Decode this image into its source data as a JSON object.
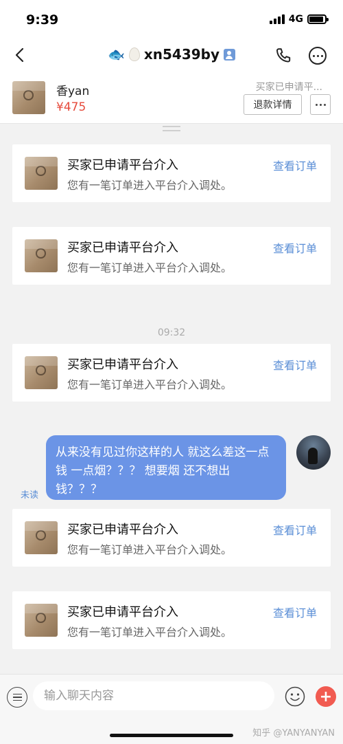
{
  "status_bar": {
    "time": "9:39",
    "network": "4G",
    "battery_level": 0.9
  },
  "header": {
    "title": "xn5439by",
    "icons": [
      "back-icon",
      "fish-icon",
      "egg-icon",
      "profile-icon",
      "phone-icon",
      "more-icon"
    ]
  },
  "product": {
    "name": "香yan",
    "price": "¥475",
    "status": "买家已申请平...",
    "refund_button": "退款详情"
  },
  "chat": {
    "timestamp": "09:32",
    "cards": [
      {
        "title": "买家已申请平台介入",
        "desc": "您有一笔订单进入平台介入调处。",
        "link": "查看订单"
      },
      {
        "title": "买家已申请平台介入",
        "desc": "您有一笔订单进入平台介入调处。",
        "link": "查看订单"
      },
      {
        "title": "买家已申请平台介入",
        "desc": "您有一笔订单进入平台介入调处。",
        "link": "查看订单"
      },
      {
        "title": "买家已申请平台介入",
        "desc": "您有一笔订单进入平台介入调处。",
        "link": "查看订单"
      },
      {
        "title": "买家已申请平台介入",
        "desc": "您有一笔订单进入平台介入调处。",
        "link": "查看订单"
      }
    ],
    "message": {
      "text": "从来没有见过你这样的人 就这么差这一点钱 一点烟？？？ 想要烟 还不想出钱？？？",
      "status": "未读"
    }
  },
  "input_bar": {
    "placeholder": "输入聊天内容",
    "watermark": "知乎 @YANYANYAN"
  },
  "colors": {
    "accent_blue": "#5a8ed6",
    "bubble": "#6b94e6",
    "price_red": "#e64a3b",
    "plus_red": "#f15b51"
  }
}
